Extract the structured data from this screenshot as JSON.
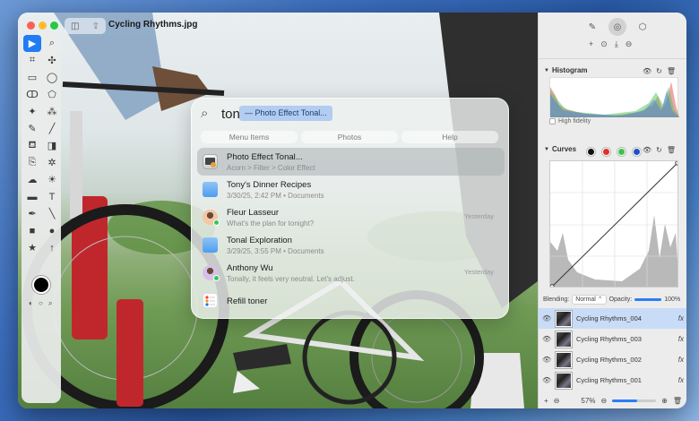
{
  "window": {
    "title": "Cycling Rhythms.jpg"
  },
  "colors": {
    "accent": "#1f7cf5",
    "selection": "#c8dcf7",
    "channel_red": "#e0302a",
    "channel_green": "#3cc24a",
    "channel_blue": "#1f4fc9"
  },
  "tools": {
    "icons": [
      "arrow-pointer-icon",
      "magnifier-icon",
      "crop-icon",
      "transform-icon",
      "rect-select-icon",
      "ellipse-select-icon",
      "lasso-icon",
      "polygon-lasso-icon",
      "magic-wand-icon",
      "color-select-icon",
      "pencil-icon",
      "brush-icon",
      "fill-icon",
      "eraser-icon",
      "clone-icon",
      "heal-icon",
      "smudge-icon",
      "lighten-icon",
      "gradient-icon",
      "text-icon",
      "pen-icon",
      "line-icon",
      "shape-rect-icon",
      "shape-ellipse-icon",
      "star-shape-icon",
      "arrow-shape-icon"
    ],
    "glyphs": [
      "▶",
      "⌕",
      "⌗",
      "✣",
      "▭",
      "◯",
      "ↀ",
      "⬠",
      "✦",
      "⁂",
      "✎",
      "╱",
      "⛾",
      "◨",
      "⎘",
      "✲",
      "☁",
      "☀",
      "▬",
      "T",
      "✒",
      "╲",
      "■",
      "●",
      "★",
      "↑"
    ]
  },
  "search": {
    "query": "ton",
    "suggestion": "— Photo Effect Tonal...",
    "scopes": [
      "Menu Items",
      "Photos",
      "Help"
    ],
    "results": [
      {
        "title": "Photo Effect Tonal...",
        "subtitle": "Acorn > Filter > Color Effect",
        "time": "",
        "icon": "filter-app-icon"
      },
      {
        "title": "Tony's Dinner Recipes",
        "subtitle": "3/30/25, 2:42 PM • Documents",
        "time": "",
        "icon": "folder-icon"
      },
      {
        "title": "Fleur Lasseur",
        "subtitle": "What's the plan for tonight?",
        "time": "Yesterday",
        "icon": "contact-avatar-icon"
      },
      {
        "title": "Tonal Exploration",
        "subtitle": "3/29/25, 3:55 PM • Documents",
        "time": "",
        "icon": "folder-icon"
      },
      {
        "title": "Anthony Wu",
        "subtitle": "Tonally, it feels very neutral. Let's adjust.",
        "time": "Yesterday",
        "icon": "contact-avatar-icon"
      },
      {
        "title": "Refill toner",
        "subtitle": "",
        "time": "",
        "icon": "reminders-icon"
      }
    ]
  },
  "inspector": {
    "histogram_label": "Histogram",
    "high_fidelity_label": "High fidelity",
    "curves_label": "Curves",
    "blending_label": "Blending:",
    "blending_mode": "Normal",
    "opacity_label": "Opacity:",
    "opacity_value": "100%",
    "opacity_fraction": 1.0,
    "layers": [
      {
        "name": "Cycling Rhythms_004",
        "selected": true
      },
      {
        "name": "Cycling Rhythms_003",
        "selected": false
      },
      {
        "name": "Cycling Rhythms_002",
        "selected": false
      },
      {
        "name": "Cycling Rhythms_001",
        "selected": false
      }
    ],
    "zoom_value": "57%",
    "zoom_fraction": 0.57,
    "fx_label": "fx"
  }
}
